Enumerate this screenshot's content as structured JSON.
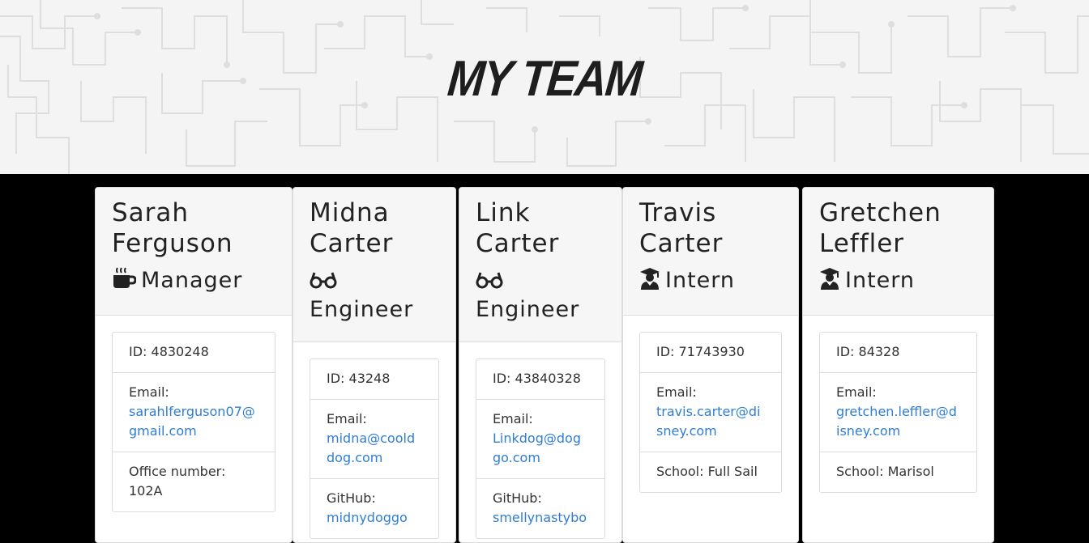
{
  "page": {
    "title": "MY TEAM"
  },
  "team": [
    {
      "first_name": "Sarah",
      "last_name": "Ferguson",
      "role": "Manager",
      "role_icon": "coffee-icon",
      "id_text": "ID: 4830248",
      "email_label": "Email:",
      "email": "sarahlferguson07@gmail.com",
      "extra_label": "Office number:",
      "extra_value": "102A"
    },
    {
      "first_name": "Midna",
      "last_name": "Carter",
      "role": "Engineer",
      "role_icon": "glasses-icon",
      "id_text": "ID: 43248",
      "email_label": "Email:",
      "email": "midna@coolddog.com",
      "extra_label": "GitHub:",
      "extra_value": "midnydoggo"
    },
    {
      "first_name": "Link",
      "last_name": "Carter",
      "role": "Engineer",
      "role_icon": "glasses-icon",
      "id_text": "ID: 43840328",
      "email_label": "Email:",
      "email": "Linkdog@doggo.com",
      "extra_label": "GitHub:",
      "extra_value": "smellynastybo"
    },
    {
      "first_name": "Travis",
      "last_name": "Carter",
      "role": "Intern",
      "role_icon": "graduate-icon",
      "id_text": "ID: 71743930",
      "email_label": "Email:",
      "email": "travis.carter@disney.com",
      "extra_text": "School: Full Sail"
    },
    {
      "first_name": "Gretchen",
      "last_name": "Leffler",
      "role": "Intern",
      "role_icon": "graduate-icon",
      "id_text": "ID: 84328",
      "email_label": "Email:",
      "email": "gretchen.leffler@disney.com",
      "extra_text": "School: Marisol"
    }
  ],
  "colors": {
    "page_background": "#000000",
    "header_background": "#f4f4f4",
    "card_header_background": "#f6f6f6",
    "link": "#2f7ed3",
    "title": "#1e1e1e"
  }
}
